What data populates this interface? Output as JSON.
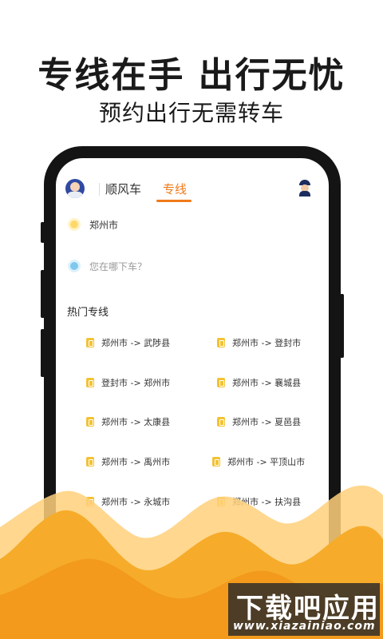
{
  "promo": {
    "headline": "专线在手 出行无忧",
    "subline": "预约出行无需转车"
  },
  "tabs": [
    {
      "label": "顺风车",
      "active": false
    },
    {
      "label": "专线",
      "active": true
    }
  ],
  "location": {
    "from": "郑州市",
    "to_placeholder": "您在哪下车？"
  },
  "hot_routes": {
    "title": "热门专线",
    "items": [
      "郑州市 -> 武陟县",
      "郑州市 -> 登封市",
      "登封市 -> 郑州市",
      "郑州市 -> 襄城县",
      "郑州市 -> 太康县",
      "郑州市 -> 夏邑县",
      "郑州市 -> 禹州市",
      "郑州市 -> 平顶山市",
      "郑州市 -> 永城市",
      "郑州市 -> 扶沟县"
    ]
  },
  "watermark": {
    "title": "下载吧应用",
    "url": "www.xiazainiao.com"
  },
  "colors": {
    "accent": "#f07a1a",
    "route_icon": "#f3c232",
    "wave_dark": "#f39a1d",
    "wave_light": "#ffd07a"
  }
}
